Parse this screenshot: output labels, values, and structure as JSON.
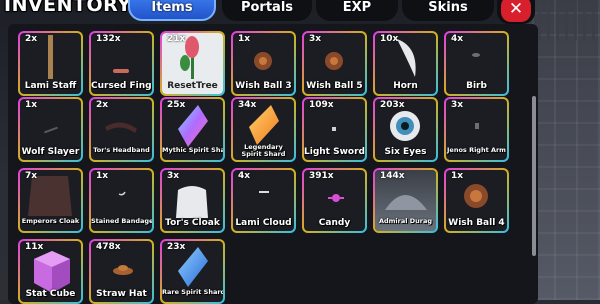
{
  "header": {
    "title": "INVENTORY",
    "tabs": [
      {
        "label": "Items",
        "active": true
      },
      {
        "label": "Portals",
        "active": false
      },
      {
        "label": "EXP",
        "active": false
      },
      {
        "label": "Skins",
        "active": false
      }
    ],
    "close_label": "✕"
  },
  "inventory": {
    "rows": [
      [
        {
          "count": "2x",
          "label": "Lami Staff"
        },
        {
          "count": "132x",
          "label": "Cursed Finger"
        },
        {
          "count": "21x",
          "label": "ResetTree"
        },
        {
          "count": "1x",
          "label": "Wish Ball 3"
        },
        {
          "count": "3x",
          "label": "Wish Ball 5"
        },
        {
          "count": "10x",
          "label": "Horn"
        },
        {
          "count": "4x",
          "label": "Birb"
        }
      ],
      [
        {
          "count": "1x",
          "label": "Wolf Slayer"
        },
        {
          "count": "2x",
          "label": "Tor's Headband"
        },
        {
          "count": "25x",
          "label": "Mythic Spirit Shard"
        },
        {
          "count": "34x",
          "label": "Legendary Spirit Shard"
        },
        {
          "count": "109x",
          "label": "Light Sword"
        },
        {
          "count": "203x",
          "label": "Six Eyes"
        },
        {
          "count": "3x",
          "label": "Jenos Right Arm"
        }
      ],
      [
        {
          "count": "7x",
          "label": "Emperors Cloak"
        },
        {
          "count": "1x",
          "label": "Stained Bandage"
        },
        {
          "count": "3x",
          "label": "Tor's Cloak"
        },
        {
          "count": "4x",
          "label": "Lami Cloud"
        },
        {
          "count": "391x",
          "label": "Candy"
        },
        {
          "count": "144x",
          "label": "Admiral Durag"
        },
        {
          "count": "1x",
          "label": "Wish Ball 4"
        }
      ],
      [
        {
          "count": "11x",
          "label": "Stat Cube"
        },
        {
          "count": "478x",
          "label": "Straw Hat"
        },
        {
          "count": "23x",
          "label": "Rare Spirit Shard"
        }
      ]
    ]
  },
  "colors": {
    "active_tab": "#2f6ae0",
    "close_button": "#d8202c",
    "slot_border_pink": "#e23be8",
    "slot_border_gold": "#d4b11d",
    "slot_border_blue": "#33c0e6"
  }
}
